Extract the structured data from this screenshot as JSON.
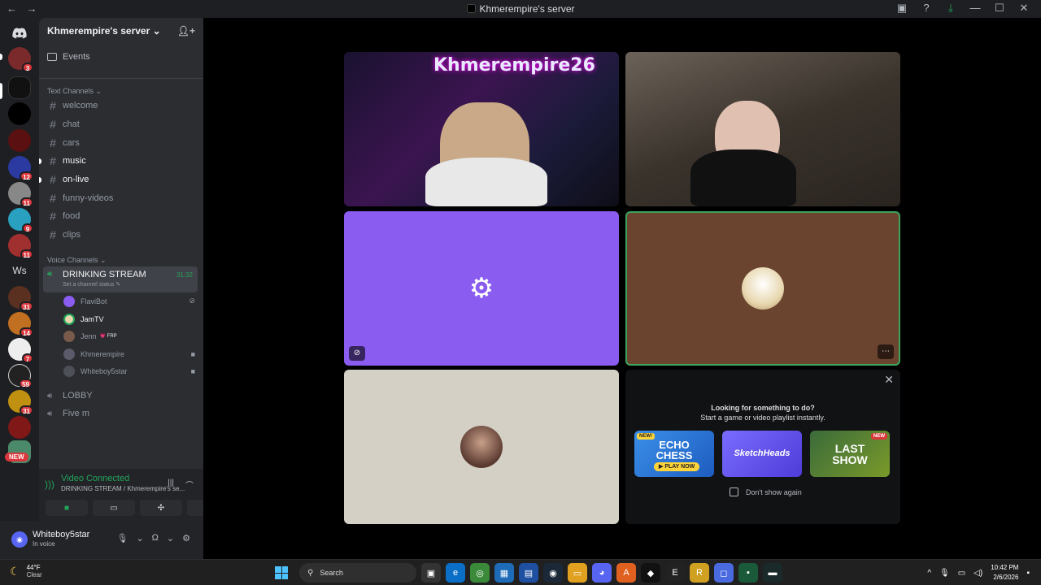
{
  "window": {
    "title": "Khmerempire's server",
    "back": "←",
    "forward": "→",
    "controls": [
      "▣",
      "?",
      "⤓",
      "—",
      "☐",
      "✕"
    ]
  },
  "guilds": {
    "dm_icon": "discord-icon",
    "badges": [
      "3",
      "12",
      "11",
      "9",
      "11",
      "31",
      "14",
      "7",
      "59",
      "31"
    ],
    "ws_label": "Ws",
    "new_label": "NEW"
  },
  "server": {
    "name": "Khmerempire's server",
    "chevron": "⌄",
    "invite_icon": "add-member-icon",
    "events_label": "Events"
  },
  "text_channels": {
    "category": "Text Channels ⌄",
    "items": [
      "welcome",
      "chat",
      "cars",
      "music",
      "on-live",
      "funny-videos",
      "food",
      "clips"
    ]
  },
  "voice_channels": {
    "category": "Voice Channels ⌄",
    "active": {
      "name": "DRINKING STREAM",
      "timer": "31:32",
      "status": "Set a channel status ✎"
    },
    "members": [
      "FlaviBot",
      "JamTV",
      "Jenn",
      "Khmerempire",
      "Whiteboy5star"
    ],
    "jenn_tag": "💗 FRP",
    "others": [
      "LOBBY",
      "Five m"
    ]
  },
  "rtc": {
    "status": "Video Connected",
    "channel": "DRINKING STREAM / Khmerempire's se..."
  },
  "user": {
    "name": "Whiteboy5star",
    "status": "In voice"
  },
  "stage": {
    "stream_overlay": "Khmerempire26"
  },
  "activity": {
    "heading": "Looking for something to do?",
    "sub": "Start a game or video playlist instantly.",
    "cards": [
      {
        "title": "ECHO CHESS",
        "cta": "▶ PLAY NOW",
        "tag": "NEW!"
      },
      {
        "title": "SketchHeads"
      },
      {
        "title": "LAST SHOW",
        "tag": "NEW"
      }
    ],
    "dont_show": "Don't show again",
    "close": "✕"
  },
  "taskbar": {
    "temp": "44°F",
    "condition": "Clear",
    "search_placeholder": "Search",
    "time": "10:42 PM",
    "date": "2/6/2026",
    "tray": [
      "^",
      "🎤",
      "🖥",
      "🔊"
    ]
  },
  "colors": {
    "accent_green": "#23a55a",
    "bot_tile": "#8a5cf0",
    "jam_tile": "#6b4430",
    "jenn_tile": "#d4d0c6"
  }
}
